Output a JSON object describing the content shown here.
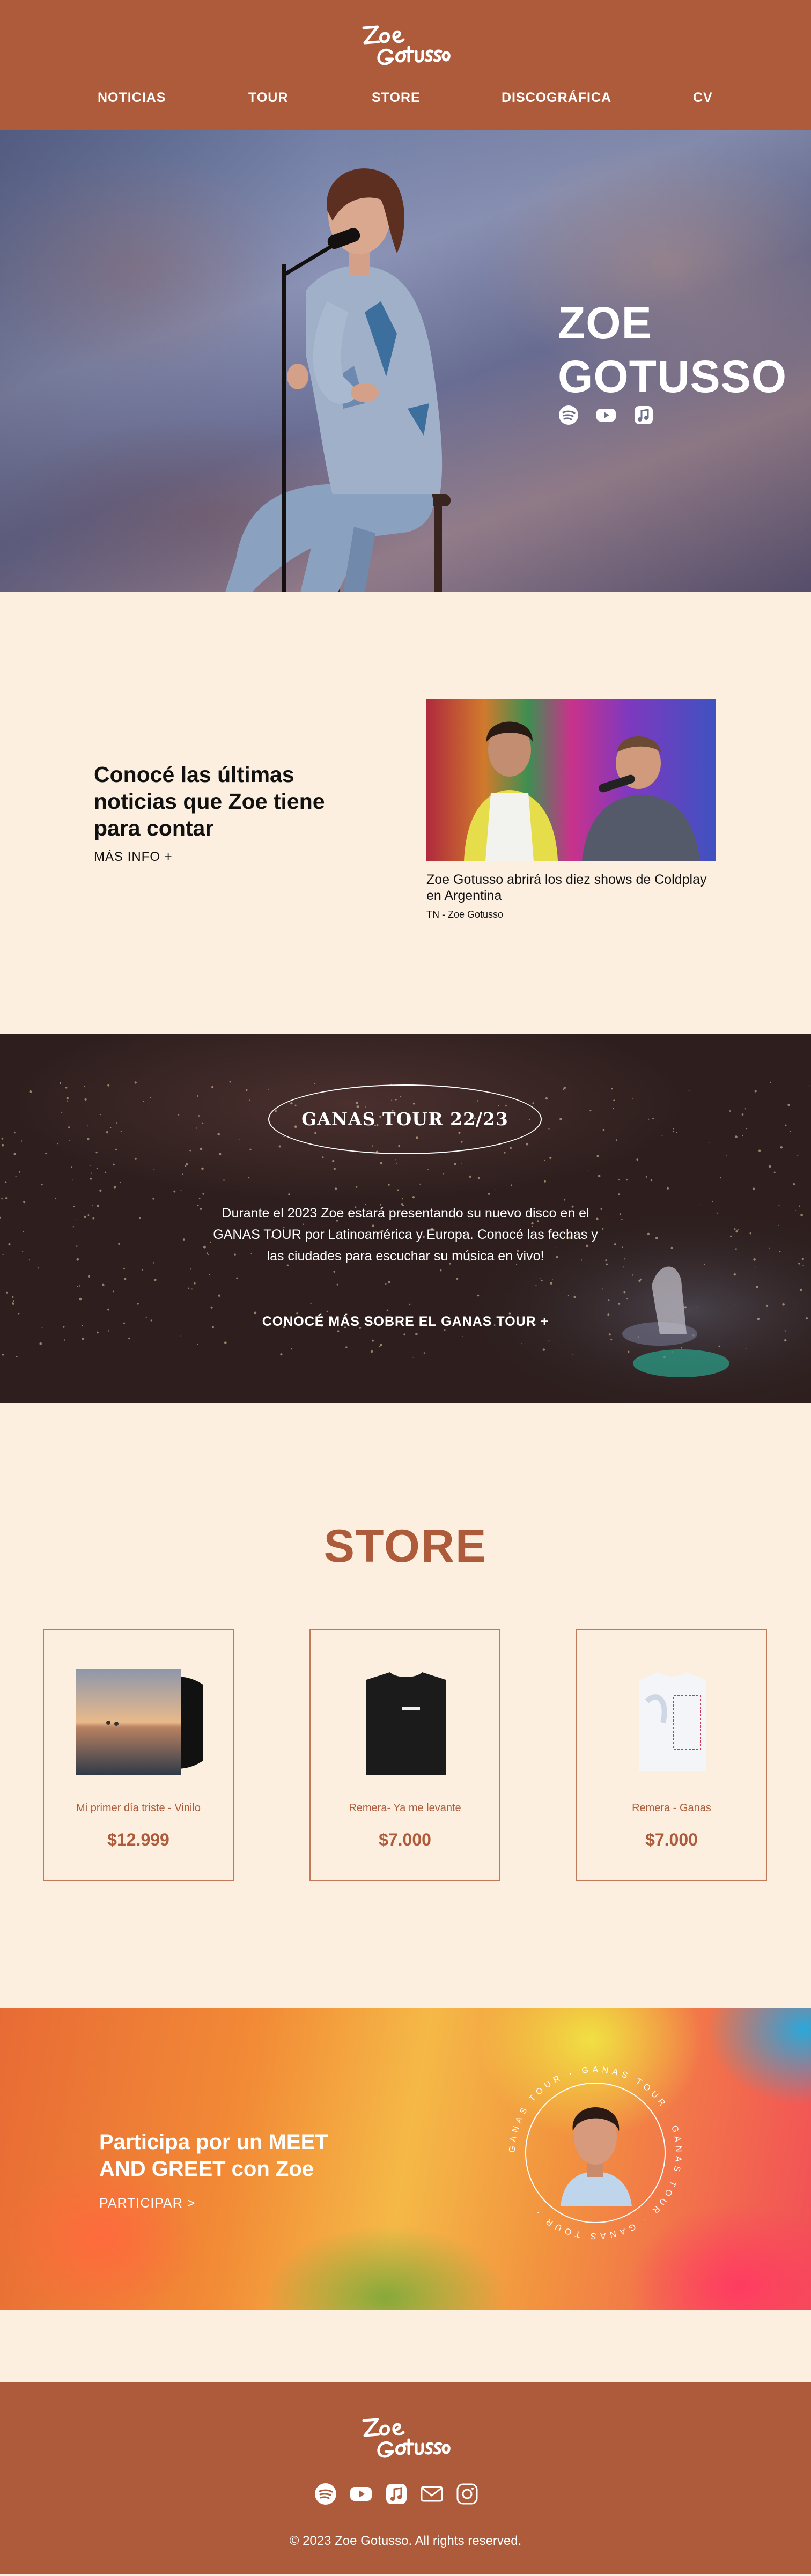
{
  "brand": {
    "logo_text": "Zoe Gotusso"
  },
  "nav": {
    "items": [
      "NOTICIAS",
      "TOUR",
      "STORE",
      "DISCOGRÁFICA",
      "CV"
    ]
  },
  "hero": {
    "title_line1": "ZOE",
    "title_line2": "GOTUSSO",
    "icons": [
      "spotify-icon",
      "youtube-icon",
      "apple-music-icon"
    ]
  },
  "news": {
    "heading": "Conocé las últimas noticias que Zoe tiene para contar",
    "more_label": "MÁS INFO +",
    "article_title": "Zoe Gotusso abrirá los diez shows de Coldplay en Argentina",
    "article_source": "TN - Zoe Gotusso"
  },
  "tour": {
    "title": "GANAS TOUR 22/23",
    "description": "Durante el 2023 Zoe estará presentando su nuevo disco en el GANAS TOUR por Latinoamérica y Europa. Conocé las fechas y las ciudades para escuchar su música en vivo!",
    "link_label": "CONOCÉ MÁS SOBRE EL GANAS TOUR +"
  },
  "store": {
    "title": "STORE",
    "products": [
      {
        "name": "Mi primer día triste - Vinilo",
        "price": "$12.999"
      },
      {
        "name": "Remera- Ya me levante",
        "price": "$7.000"
      },
      {
        "name": "Remera - Ganas",
        "price": "$7.000"
      }
    ]
  },
  "meet": {
    "title": "Participa por un MEET AND GREET con Zoe",
    "link_label": "PARTICIPAR >",
    "badge_text": "GANAS TOUR · GANAS TOUR · GANAS TOUR · GANAS TOUR · "
  },
  "footer": {
    "icons": [
      "spotify-icon",
      "youtube-icon",
      "apple-music-icon",
      "mail-icon",
      "instagram-icon"
    ],
    "copyright": "© 2023 Zoe Gotusso. All rights reserved."
  },
  "colors": {
    "brand": "#ad5b3a",
    "cream": "#fcefdf"
  }
}
